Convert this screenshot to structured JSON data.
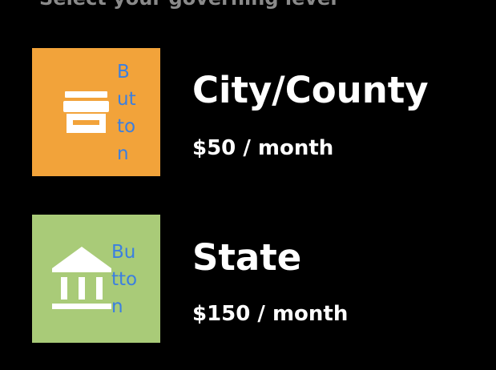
{
  "header": {
    "subtitle": "Select your governing level"
  },
  "options": [
    {
      "name": "City/County",
      "price": "$50 / month",
      "button_label": "Button",
      "icon": "storefront-icon",
      "color": "#f2a33a"
    },
    {
      "name": "State",
      "price": "$150 / month",
      "button_label": "Button",
      "icon": "government-building-icon",
      "color": "#a9cb78"
    }
  ]
}
